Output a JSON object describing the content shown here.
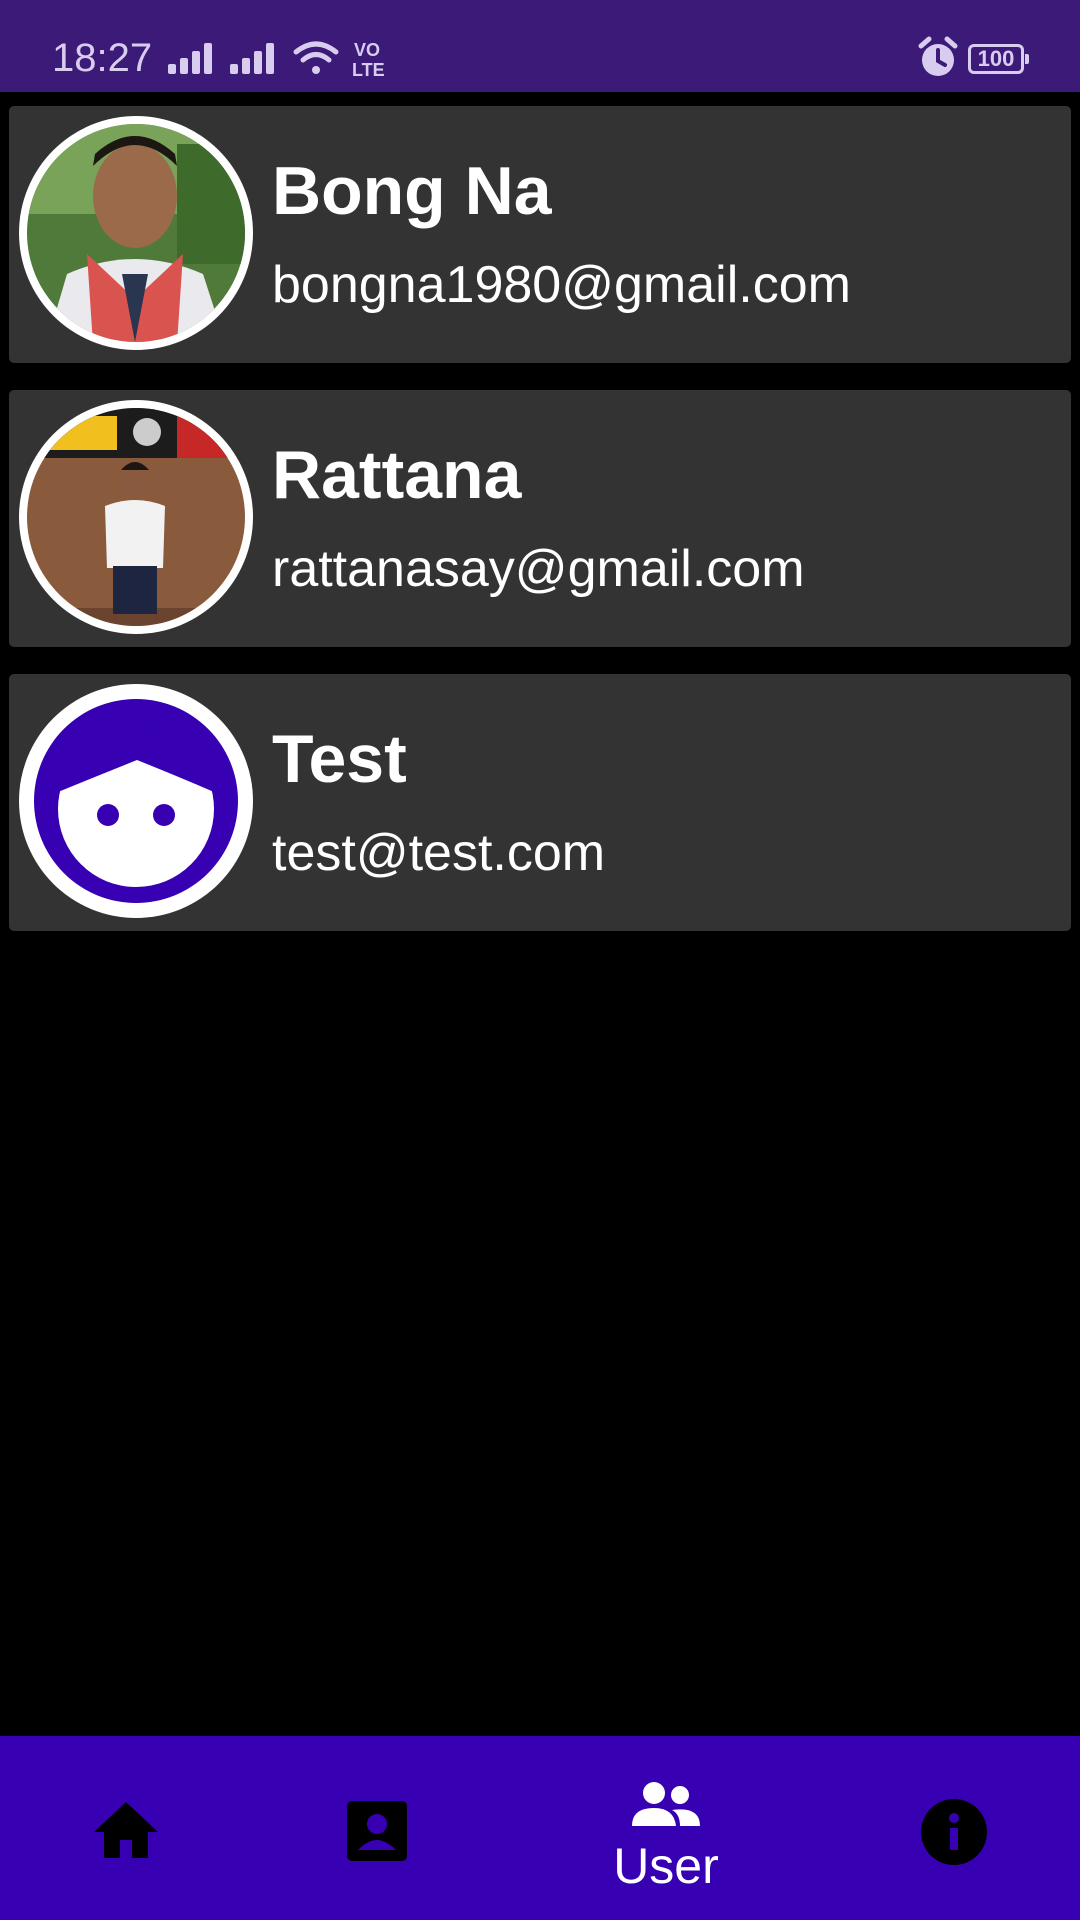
{
  "status_bar": {
    "time": "18:27",
    "network_icons": [
      "signal-icon",
      "signal-icon",
      "wifi-icon",
      "volte-icon"
    ],
    "alarm_icon": "alarm-icon",
    "battery_level": "100"
  },
  "users": [
    {
      "name": "Bong Na",
      "email": "bongna1980@gmail.com",
      "avatar": "photo"
    },
    {
      "name": "Rattana",
      "email": "rattanasay@gmail.com",
      "avatar": "photo"
    },
    {
      "name": "Test",
      "email": "test@test.com",
      "avatar": "default-face-icon"
    }
  ],
  "bottom_nav": {
    "items": [
      {
        "icon": "home-icon",
        "label": ""
      },
      {
        "icon": "contact-icon",
        "label": ""
      },
      {
        "icon": "users-icon",
        "label": "User",
        "active": true
      },
      {
        "icon": "info-icon",
        "label": ""
      }
    ]
  },
  "colors": {
    "status_bar": "#3c1a78",
    "card_background": "#333333",
    "nav_background": "#3700b3",
    "default_avatar": "#3700b3"
  }
}
